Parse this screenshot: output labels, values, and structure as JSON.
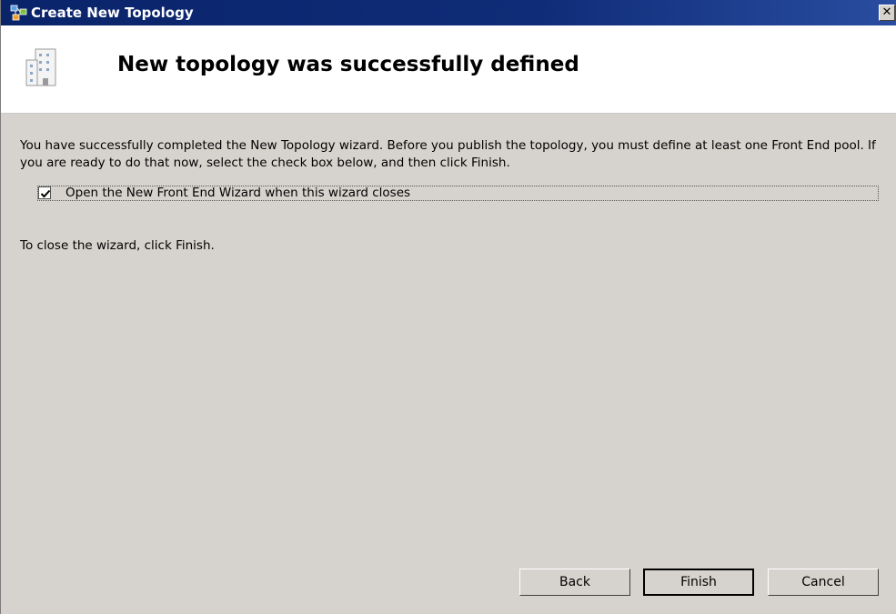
{
  "window": {
    "title": "Create New Topology",
    "close_label": "✕"
  },
  "header": {
    "title": "New topology was successfully defined"
  },
  "content": {
    "description": "You have successfully completed the New Topology wizard. Before you publish the topology, you must define at least one Front End pool. If you are ready to do that now, select the check box below, and then click Finish.",
    "checkbox_label": "Open the New Front End Wizard when this wizard closes",
    "checkbox_checked": true,
    "close_note": "To close the wizard, click Finish."
  },
  "buttons": {
    "back": "Back",
    "finish": "Finish",
    "cancel": "Cancel"
  },
  "colors": {
    "titlebar": "#0a246a",
    "dialog_bg": "#d6d3ce",
    "header_bg": "#ffffff"
  },
  "icons": {
    "title": "topology-icon",
    "header": "building-icon",
    "checkmark": "checkmark-icon"
  }
}
